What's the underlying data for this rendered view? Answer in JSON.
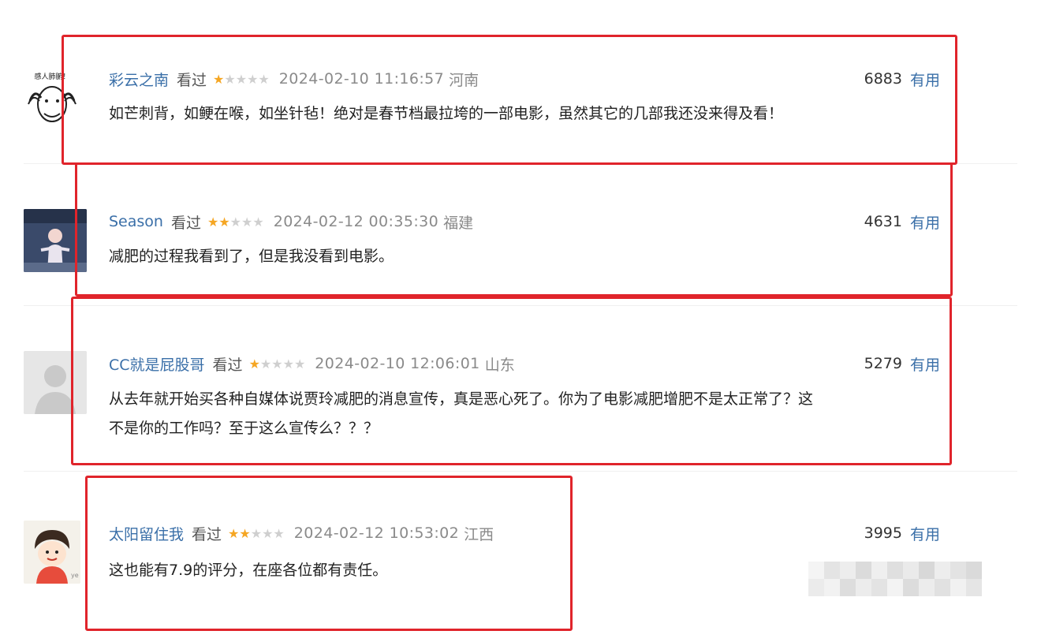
{
  "comments": [
    {
      "username": "彩云之南",
      "watched": "看过",
      "rating": 1,
      "time": "2024-02-10 11:16:57",
      "location": "河南",
      "votes": "6883",
      "useful_label": "有用",
      "text": "如芒刺背，如鲠在喉，如坐针毡！绝对是春节档最拉垮的一部电影，虽然其它的几部我还没来得及看！",
      "avatar_caption": "感人肺腑！"
    },
    {
      "username": "Season",
      "watched": "看过",
      "rating": 2,
      "time": "2024-02-12 00:35:30",
      "location": "福建",
      "votes": "4631",
      "useful_label": "有用",
      "text": "减肥的过程我看到了，但是我没看到电影。"
    },
    {
      "username": "CC就是屁股哥",
      "watched": "看过",
      "rating": 1,
      "time": "2024-02-10 12:06:01",
      "location": "山东",
      "votes": "5279",
      "useful_label": "有用",
      "text_line1": "从去年就开始买各种自媒体说贾玲减肥的消息宣传，真是恶心死了。你为了电影减肥增肥不是太正常了？这",
      "text_line2": "不是你的工作吗？至于这么宣传么？？？"
    },
    {
      "username": "太阳留住我",
      "watched": "看过",
      "rating": 2,
      "time": "2024-02-12 10:53:02",
      "location": "江西",
      "votes": "3995",
      "useful_label": "有用",
      "text": "这也能有7.9的评分，在座各位都有责任。"
    }
  ],
  "colors": {
    "highlight_border": "#e0242b",
    "star_on": "#f5a623",
    "star_off": "#cfcfcf",
    "link": "#3a6fa8"
  }
}
